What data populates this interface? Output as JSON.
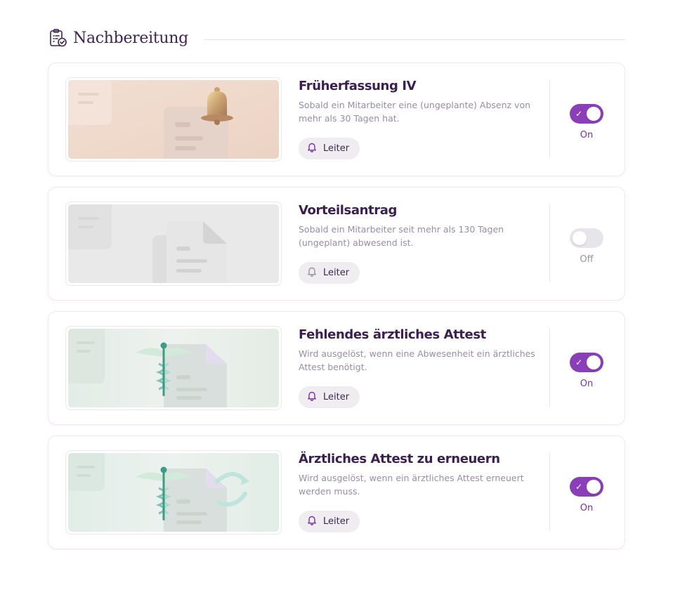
{
  "section": {
    "title": "Nachbereitung",
    "icon": "clipboard-check-icon"
  },
  "accent_color": "#8a3fb8",
  "rules": [
    {
      "title": "Früherfassung IV",
      "description": "Sobald ein Mitarbeiter eine (ungeplante) Absenz von mehr als 30 Tagen hat.",
      "chip_label": "Leiter",
      "chip_icon": "bell-icon",
      "enabled": true,
      "state_label": "On",
      "illustration": "bell-document-illustration"
    },
    {
      "title": "Vorteilsantrag",
      "description": "Sobald ein Mitarbeiter seit mehr als 130 Tagen (ungeplant) abwesend ist.",
      "chip_label": "Leiter",
      "chip_icon": "bell-icon",
      "enabled": false,
      "state_label": "Off",
      "illustration": "documents-illustration"
    },
    {
      "title": "Fehlendes ärztliches Attest",
      "description": "Wird ausgelöst, wenn eine Abwesenheit ein ärztliches Attest benötigt.",
      "chip_label": "Leiter",
      "chip_icon": "bell-icon",
      "enabled": true,
      "state_label": "On",
      "illustration": "caduceus-document-illustration"
    },
    {
      "title": "Ärztliches Attest zu erneuern",
      "description": "Wird ausgelöst, wenn ein ärztliches Attest erneuert werden muss.",
      "chip_label": "Leiter",
      "chip_icon": "bell-icon",
      "enabled": true,
      "state_label": "On",
      "illustration": "caduceus-refresh-illustration"
    }
  ]
}
